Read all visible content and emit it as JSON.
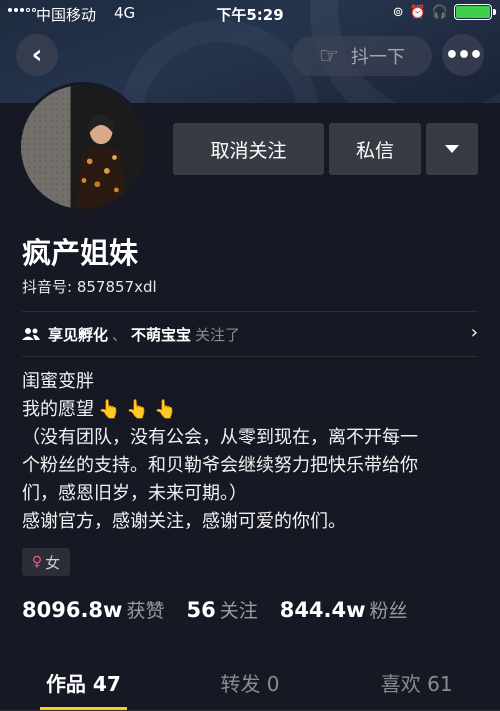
{
  "status_bar": {
    "carrier": "中国移动",
    "network": "4G",
    "time": "下午5:29"
  },
  "nav": {
    "back_icon": "chevron-left-icon",
    "shake_label": "抖一下",
    "more_icon": "ellipsis-icon"
  },
  "profile": {
    "name": "疯产姐妹",
    "douyin_id": "抖音号: 857857xdl",
    "avatar_icon": "avatar-photo"
  },
  "actions": {
    "unfollow": "取消关注",
    "message": "私信"
  },
  "mutual": {
    "user1": "享见孵化",
    "separator": "、",
    "user2": "不萌宝宝",
    "suffix": "关注了",
    "arrow": "›"
  },
  "bio": {
    "line1": "闺蜜变胖",
    "line2": "我的愿望",
    "fingers": "👆 👆 👆",
    "line3": "（没有团队，没有公会，从零到现在，离不开每一",
    "line4": "个粉丝的支持。和贝勒爷会继续努力把快乐带给你",
    "line5": "们，感恩旧岁，未来可期。）",
    "line6": "感谢官方，感谢关注，感谢可爱的你们。"
  },
  "gender": {
    "icon": "female-icon",
    "label": "女"
  },
  "stats": {
    "likes_num": "8096.8w",
    "likes_label": "获赞",
    "following_num": "56",
    "following_label": "关注",
    "followers_num": "844.4w",
    "followers_label": "粉丝"
  },
  "tabs": {
    "works": "作品 47",
    "reposts": "转发 0",
    "likes": "喜欢 61"
  },
  "colors": {
    "background": "#161823",
    "button": "#393b44",
    "accent": "#face15"
  }
}
